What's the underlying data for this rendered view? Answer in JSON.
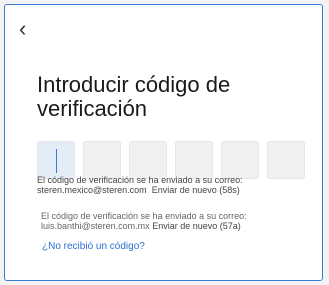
{
  "header": {
    "back_icon": "chevron-left-icon",
    "back_glyph": "‹"
  },
  "title": {
    "line1": "Introducir código de",
    "line2": "verificación"
  },
  "code_input": {
    "box_count": 6,
    "active_index": 0,
    "accent": "#3a7bd5"
  },
  "notice_primary": {
    "line1": "El código de verificación se ha enviado a su correo:",
    "email": "steren.mexico@steren.com",
    "resend": "Enviar de nuevo (58s)"
  },
  "notice_secondary": {
    "line1": "El código de verificación se ha enviado a su correo:",
    "email": "luis.banthi@steren.com.mx",
    "resend": "Enviar de nuevo (57a)"
  },
  "help_link": {
    "label": "¿No recibió un código?"
  }
}
